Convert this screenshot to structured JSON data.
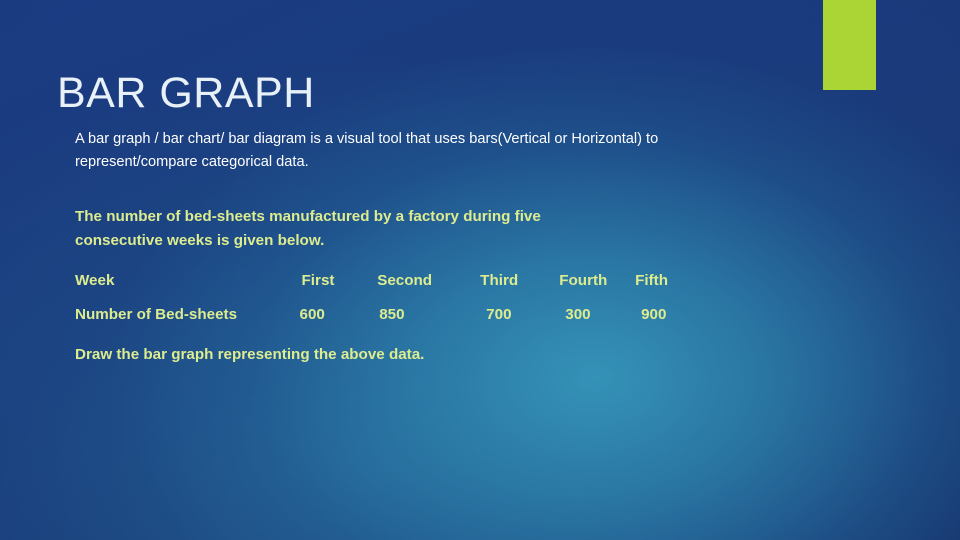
{
  "slide": {
    "title": "BAR GRAPH",
    "accent_color": "#abd435",
    "title_color": "#e9f1f8",
    "highlight_text_color": "#dcec8f",
    "body_text_color": "#ffffff",
    "background_colors": [
      "#1b3c82",
      "#2d82ac",
      "#16306a"
    ]
  },
  "definition": {
    "text": "A bar graph / bar chart/ bar diagram is a visual tool that uses bars(Vertical or Horizontal) to represent/compare categorical data."
  },
  "problem": {
    "line1": "The number of bed-sheets manufactured by a factory during five",
    "line2": "consecutive weeks is given below."
  },
  "table": {
    "header_label": "Week",
    "row_label": "Number of Bed-sheets",
    "columns": [
      "First",
      "Second",
      "Third",
      "Fourth",
      "Fifth"
    ],
    "values": [
      "600",
      "850",
      "700",
      "300",
      "900"
    ]
  },
  "instruction": {
    "text": "Draw the bar graph representing the above data."
  },
  "chart_data": {
    "type": "bar",
    "title": "BAR GRAPH",
    "categories": [
      "First",
      "Second",
      "Third",
      "Fourth",
      "Fifth"
    ],
    "values": [
      600,
      850,
      700,
      300,
      900
    ],
    "xlabel": "Week",
    "ylabel": "Number of Bed-sheets",
    "ylim": [
      0,
      900
    ],
    "grid": false,
    "legend": "none",
    "note": "Data table given on slide; bar graph is to be drawn by the student."
  }
}
